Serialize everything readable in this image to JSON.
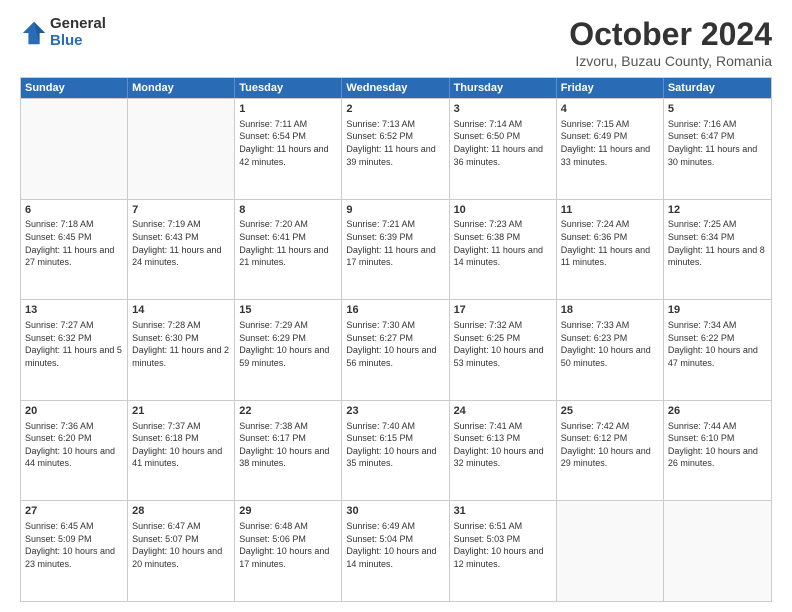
{
  "logo": {
    "general": "General",
    "blue": "Blue"
  },
  "title": "October 2024",
  "location": "Izvoru, Buzau County, Romania",
  "header_days": [
    "Sunday",
    "Monday",
    "Tuesday",
    "Wednesday",
    "Thursday",
    "Friday",
    "Saturday"
  ],
  "weeks": [
    [
      {
        "day": "",
        "text": "",
        "empty": true
      },
      {
        "day": "",
        "text": "",
        "empty": true
      },
      {
        "day": "1",
        "text": "Sunrise: 7:11 AM\nSunset: 6:54 PM\nDaylight: 11 hours and 42 minutes."
      },
      {
        "day": "2",
        "text": "Sunrise: 7:13 AM\nSunset: 6:52 PM\nDaylight: 11 hours and 39 minutes."
      },
      {
        "day": "3",
        "text": "Sunrise: 7:14 AM\nSunset: 6:50 PM\nDaylight: 11 hours and 36 minutes."
      },
      {
        "day": "4",
        "text": "Sunrise: 7:15 AM\nSunset: 6:49 PM\nDaylight: 11 hours and 33 minutes."
      },
      {
        "day": "5",
        "text": "Sunrise: 7:16 AM\nSunset: 6:47 PM\nDaylight: 11 hours and 30 minutes."
      }
    ],
    [
      {
        "day": "6",
        "text": "Sunrise: 7:18 AM\nSunset: 6:45 PM\nDaylight: 11 hours and 27 minutes."
      },
      {
        "day": "7",
        "text": "Sunrise: 7:19 AM\nSunset: 6:43 PM\nDaylight: 11 hours and 24 minutes."
      },
      {
        "day": "8",
        "text": "Sunrise: 7:20 AM\nSunset: 6:41 PM\nDaylight: 11 hours and 21 minutes."
      },
      {
        "day": "9",
        "text": "Sunrise: 7:21 AM\nSunset: 6:39 PM\nDaylight: 11 hours and 17 minutes."
      },
      {
        "day": "10",
        "text": "Sunrise: 7:23 AM\nSunset: 6:38 PM\nDaylight: 11 hours and 14 minutes."
      },
      {
        "day": "11",
        "text": "Sunrise: 7:24 AM\nSunset: 6:36 PM\nDaylight: 11 hours and 11 minutes."
      },
      {
        "day": "12",
        "text": "Sunrise: 7:25 AM\nSunset: 6:34 PM\nDaylight: 11 hours and 8 minutes."
      }
    ],
    [
      {
        "day": "13",
        "text": "Sunrise: 7:27 AM\nSunset: 6:32 PM\nDaylight: 11 hours and 5 minutes."
      },
      {
        "day": "14",
        "text": "Sunrise: 7:28 AM\nSunset: 6:30 PM\nDaylight: 11 hours and 2 minutes."
      },
      {
        "day": "15",
        "text": "Sunrise: 7:29 AM\nSunset: 6:29 PM\nDaylight: 10 hours and 59 minutes."
      },
      {
        "day": "16",
        "text": "Sunrise: 7:30 AM\nSunset: 6:27 PM\nDaylight: 10 hours and 56 minutes."
      },
      {
        "day": "17",
        "text": "Sunrise: 7:32 AM\nSunset: 6:25 PM\nDaylight: 10 hours and 53 minutes."
      },
      {
        "day": "18",
        "text": "Sunrise: 7:33 AM\nSunset: 6:23 PM\nDaylight: 10 hours and 50 minutes."
      },
      {
        "day": "19",
        "text": "Sunrise: 7:34 AM\nSunset: 6:22 PM\nDaylight: 10 hours and 47 minutes."
      }
    ],
    [
      {
        "day": "20",
        "text": "Sunrise: 7:36 AM\nSunset: 6:20 PM\nDaylight: 10 hours and 44 minutes."
      },
      {
        "day": "21",
        "text": "Sunrise: 7:37 AM\nSunset: 6:18 PM\nDaylight: 10 hours and 41 minutes."
      },
      {
        "day": "22",
        "text": "Sunrise: 7:38 AM\nSunset: 6:17 PM\nDaylight: 10 hours and 38 minutes."
      },
      {
        "day": "23",
        "text": "Sunrise: 7:40 AM\nSunset: 6:15 PM\nDaylight: 10 hours and 35 minutes."
      },
      {
        "day": "24",
        "text": "Sunrise: 7:41 AM\nSunset: 6:13 PM\nDaylight: 10 hours and 32 minutes."
      },
      {
        "day": "25",
        "text": "Sunrise: 7:42 AM\nSunset: 6:12 PM\nDaylight: 10 hours and 29 minutes."
      },
      {
        "day": "26",
        "text": "Sunrise: 7:44 AM\nSunset: 6:10 PM\nDaylight: 10 hours and 26 minutes."
      }
    ],
    [
      {
        "day": "27",
        "text": "Sunrise: 6:45 AM\nSunset: 5:09 PM\nDaylight: 10 hours and 23 minutes."
      },
      {
        "day": "28",
        "text": "Sunrise: 6:47 AM\nSunset: 5:07 PM\nDaylight: 10 hours and 20 minutes."
      },
      {
        "day": "29",
        "text": "Sunrise: 6:48 AM\nSunset: 5:06 PM\nDaylight: 10 hours and 17 minutes."
      },
      {
        "day": "30",
        "text": "Sunrise: 6:49 AM\nSunset: 5:04 PM\nDaylight: 10 hours and 14 minutes."
      },
      {
        "day": "31",
        "text": "Sunrise: 6:51 AM\nSunset: 5:03 PM\nDaylight: 10 hours and 12 minutes."
      },
      {
        "day": "",
        "text": "",
        "empty": true
      },
      {
        "day": "",
        "text": "",
        "empty": true
      }
    ]
  ]
}
